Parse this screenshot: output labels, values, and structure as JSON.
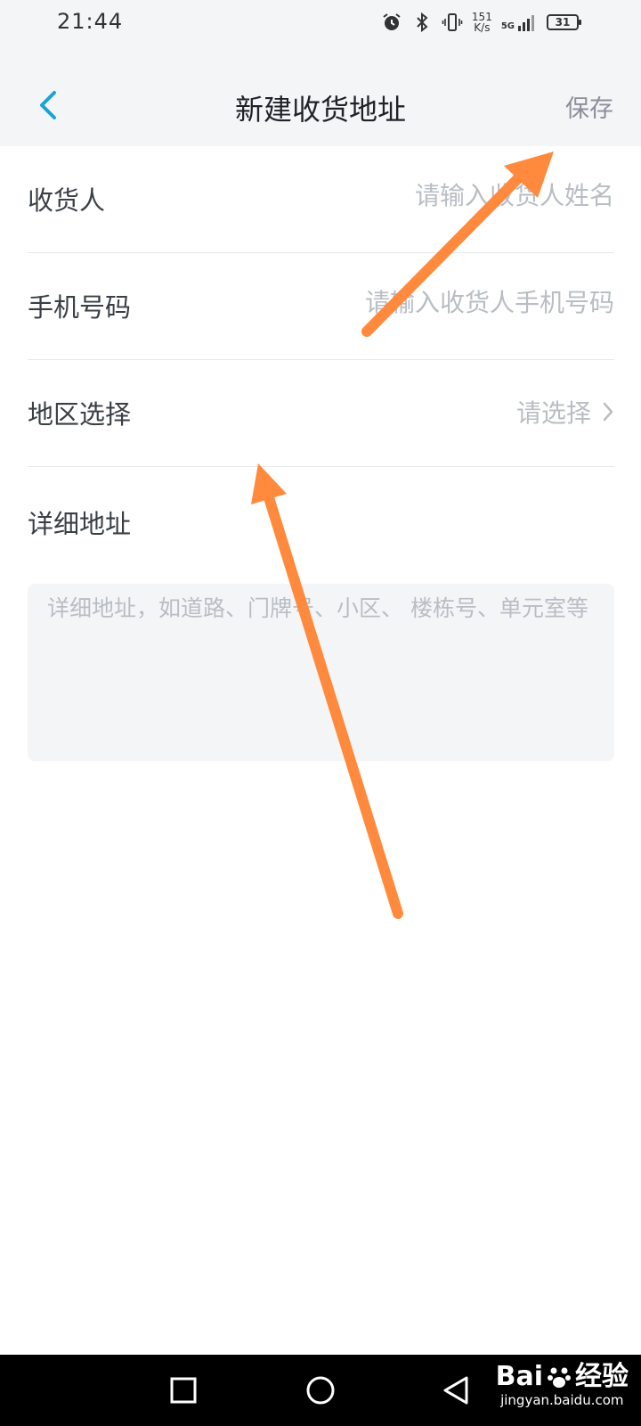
{
  "status_bar": {
    "time": "21:44",
    "net_speed_value": "151",
    "net_speed_unit": "K/s",
    "signal_label": "5G",
    "battery": "31",
    "icons": [
      "alarm-icon",
      "bluetooth-icon",
      "vibrate-icon",
      "signal-icon",
      "battery-icon"
    ]
  },
  "header": {
    "back_icon": "chevron-left-icon",
    "title": "新建收货地址",
    "save_label": "保存"
  },
  "form": {
    "receiver": {
      "label": "收货人",
      "placeholder": "请输入收货人姓名",
      "value": ""
    },
    "phone": {
      "label": "手机号码",
      "placeholder": "请输入收货人手机号码",
      "value": ""
    },
    "region": {
      "label": "地区选择",
      "value_text": "请选择",
      "icon": "chevron-right-icon"
    },
    "detail": {
      "label": "详细地址",
      "placeholder": "详细地址，如道路、门牌号、小区、 楼栋号、单元室等",
      "value": ""
    }
  },
  "annotation": {
    "arrow_color": "#ff8a3d"
  },
  "nav_bar": {
    "buttons": [
      "recent-apps-icon",
      "home-icon",
      "back-triangle-icon"
    ]
  },
  "watermark": {
    "brand": "Bai",
    "brand_suffix": "经验",
    "url": "jingyan.baidu.com"
  },
  "colors": {
    "accent": "#1aa3d9",
    "header_bg": "#f4f5f7",
    "placeholder": "#b9bdc4",
    "label": "#3a3f46"
  }
}
